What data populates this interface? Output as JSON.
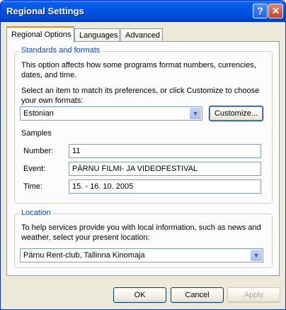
{
  "window": {
    "title": "Regional Settings"
  },
  "titlebar": {
    "help_label": "?",
    "close_label": "✕"
  },
  "tabs": [
    {
      "label": "Regional Options",
      "active": true
    },
    {
      "label": "Languages",
      "active": false
    },
    {
      "label": "Advanced",
      "active": false
    }
  ],
  "standards": {
    "legend": "Standards and formats",
    "description": "This option affects how some programs format numbers, currencies, dates, and time.",
    "instruction": "Select an item to match its preferences, or click Customize to choose your own formats:",
    "selected_locale": "Estonian",
    "customize_label": "Customize..."
  },
  "samples": {
    "heading": "Samples",
    "rows": [
      {
        "label": "Number:",
        "value": "11"
      },
      {
        "label": "Event:",
        "value": "PÄRNU FILMI- JA VIDEOFESTIVAL"
      },
      {
        "label": "Time:",
        "value": "15. - 16. 10. 2005"
      }
    ]
  },
  "location": {
    "legend": "Location",
    "description": "To help services provide you with local information, such as news and weather, select your present location:",
    "selected": "Pärnu Rent-club, Tallinna Kinomaja"
  },
  "footer": {
    "ok_label": "OK",
    "cancel_label": "Cancel",
    "apply_label": "Apply"
  },
  "colors": {
    "title_bar": "#0055e5",
    "legend_text": "#0046d5",
    "active_tab_accent": "#e68b2c"
  }
}
